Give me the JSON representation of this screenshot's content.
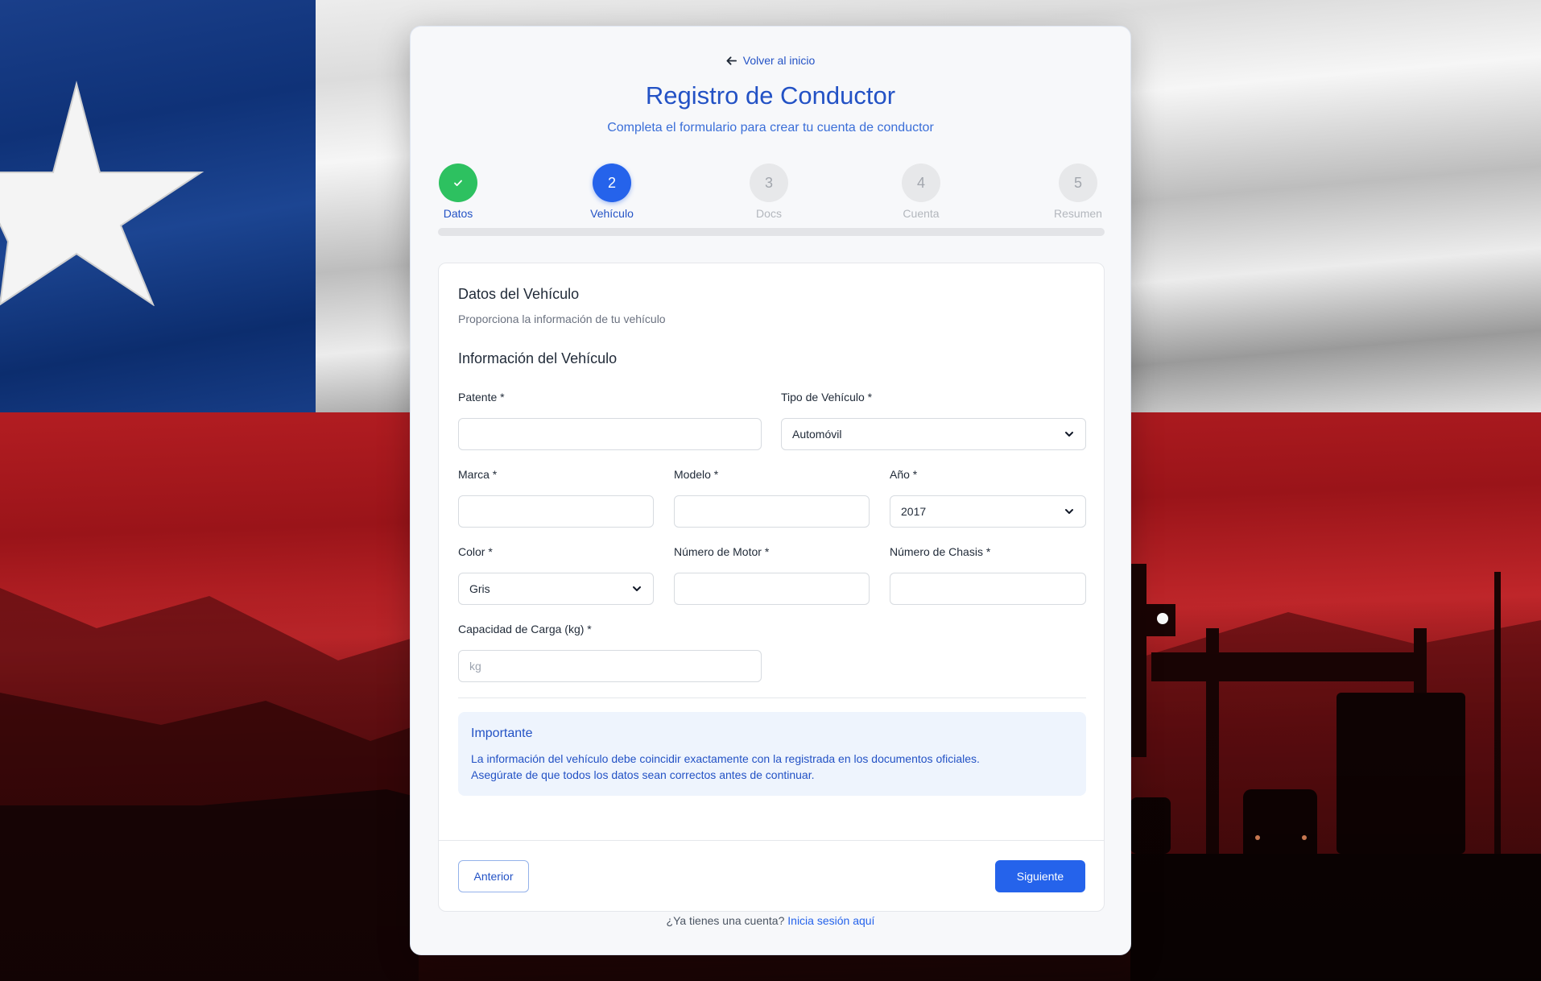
{
  "back_link": "Volver al inicio",
  "title": "Registro de Conductor",
  "subtitle": "Completa el formulario para crear tu cuenta de conductor",
  "steps": [
    {
      "num": "✓",
      "label": "Datos",
      "state": "done"
    },
    {
      "num": "2",
      "label": "Vehículo",
      "state": "active"
    },
    {
      "num": "3",
      "label": "Docs",
      "state": "pending"
    },
    {
      "num": "4",
      "label": "Cuenta",
      "state": "pending"
    },
    {
      "num": "5",
      "label": "Resumen",
      "state": "pending"
    }
  ],
  "panel": {
    "title": "Datos del Vehículo",
    "description": "Proporciona la información de tu vehículo",
    "section_title": "Información del Vehículo"
  },
  "fields": {
    "patente": {
      "label": "Patente *",
      "value": ""
    },
    "tipo": {
      "label": "Tipo de Vehículo *",
      "value": "Automóvil"
    },
    "marca": {
      "label": "Marca *",
      "value": ""
    },
    "modelo": {
      "label": "Modelo *",
      "value": ""
    },
    "anio": {
      "label": "Año *",
      "value": "2017"
    },
    "color": {
      "label": "Color *",
      "value": "Gris"
    },
    "motor": {
      "label": "Número de Motor *",
      "value": ""
    },
    "chasis": {
      "label": "Número de Chasis *",
      "value": ""
    },
    "capacidad": {
      "label": "Capacidad de Carga (kg) *",
      "value": "",
      "placeholder": "kg"
    }
  },
  "notice": {
    "title": "Importante",
    "line1": "La información del vehículo debe coincidir exactamente con la registrada en los documentos oficiales.",
    "line2": "Asegúrate de que todos los datos sean correctos antes de continuar."
  },
  "buttons": {
    "prev": "Anterior",
    "next": "Siguiente"
  },
  "footer": {
    "text": "¿Ya tienes una cuenta?",
    "link": "Inicia sesión aquí"
  },
  "colors": {
    "primary": "#2563eb",
    "success": "#2dc160",
    "flag_blue": "#0f3278",
    "flag_red": "#b31d22"
  }
}
